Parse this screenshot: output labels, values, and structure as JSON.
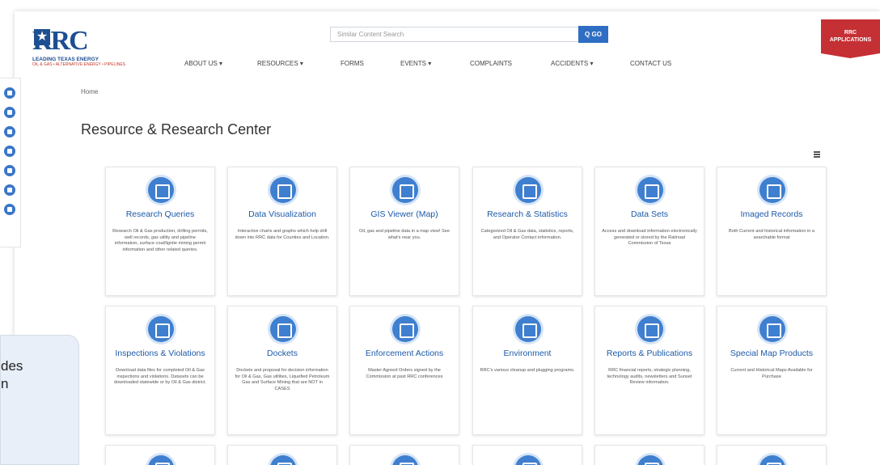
{
  "header": {
    "logo_text": "RRC",
    "logo_tagline": "LEADING TEXAS ENERGY",
    "logo_subtagline": "OIL & GAS • ALTERNATIVE ENERGY • PIPELINES",
    "search_placeholder": "Similar Content Search",
    "go_label": "Q GO",
    "apps_label_1": "RRC",
    "apps_label_2": "APPLICATIONS"
  },
  "nav": [
    {
      "label": "ABOUT US ▾",
      "name": "nav-about-us"
    },
    {
      "label": "RESOURCES ▾",
      "name": "nav-resources"
    },
    {
      "label": "FORMS",
      "name": "nav-forms"
    },
    {
      "label": "EVENTS ▾",
      "name": "nav-events"
    },
    {
      "label": "COMPLAINTS",
      "name": "nav-complaints"
    },
    {
      "label": "ACCIDENTS ▾",
      "name": "nav-accidents"
    },
    {
      "label": "CONTACT US",
      "name": "nav-contact-us"
    }
  ],
  "sidebar_icons": [
    "building-icon",
    "oil-drop-icon",
    "flame-icon",
    "car-icon",
    "leaf-icon",
    "anchor-icon",
    "book-icon"
  ],
  "breadcrumb": "Home",
  "page_title": "Resource & Research Center",
  "cards": [
    {
      "title": "Research Queries",
      "icon": "research-icon",
      "desc": "Research Oil & Gas production, drilling permits, well records, gas utility and pipeline information, surface coal/lignite mining permit information and other related queries."
    },
    {
      "title": "Data Visualization",
      "icon": "texas-map-icon",
      "desc": "Interactive charts and graphs which help drill down into RRC data for Counties and Location."
    },
    {
      "title": "GIS Viewer (Map)",
      "icon": "map-pin-icon",
      "desc": "Oil, gas and pipeline data in a map view! See what's near you."
    },
    {
      "title": "Research & Statistics",
      "icon": "statistics-icon",
      "desc": "Categorized Oil & Gas data, statistics, reports, and Operator Contact information."
    },
    {
      "title": "Data Sets",
      "icon": "database-icon",
      "desc": "Access and download information electronically generated or stored by the Railroad Commission of Texas"
    },
    {
      "title": "Imaged Records",
      "icon": "monitor-icon",
      "desc": "Both Current and historical information in a searchable format"
    },
    {
      "title": "Inspections & Violations",
      "icon": "magnifier-icon",
      "desc": "Download data files for completed Oil & Gas inspections and violations. Datasets can be downloaded statewide or by Oil & Gas district."
    },
    {
      "title": "Dockets",
      "icon": "scales-icon",
      "desc": "Dockets and proposal for decision information for Oil & Gas, Gas utilities, Liquefied Petroleum Gas and Surface Mining that are NOT in CASES"
    },
    {
      "title": "Enforcement Actions",
      "icon": "gavel-icon",
      "desc": "Master Agreed Orders signed by the Commission at past RRC conferences"
    },
    {
      "title": "Environment",
      "icon": "environment-icon",
      "desc": "RRC's various cleanup and plugging programs."
    },
    {
      "title": "Reports & Publications",
      "icon": "book-icon",
      "desc": "RRC financial reports, strategic planning, technology audits, newsletters and Sunset Review information."
    },
    {
      "title": "Special Map Products",
      "icon": "texas-icon",
      "desc": "Current and Historical Maps Available for Purchase"
    }
  ],
  "chat_line_1": "des",
  "chat_line_2": "n"
}
